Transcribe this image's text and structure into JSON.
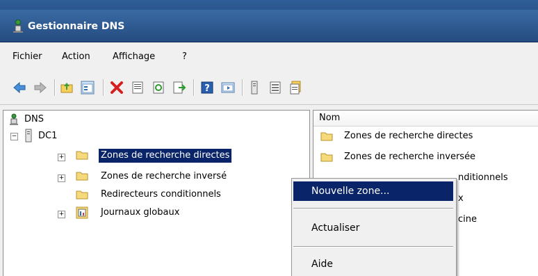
{
  "window": {
    "title": "Gestionnaire DNS"
  },
  "menu": {
    "items": [
      "Fichier",
      "Action",
      "Affichage",
      "?"
    ]
  },
  "toolbar": {
    "buttons": [
      "back-icon",
      "forward-icon",
      "up-folder-icon",
      "show-hide-tree-icon",
      "delete-icon",
      "properties-icon",
      "refresh-icon",
      "export-icon",
      "help-icon",
      "console-icon",
      "server-icon",
      "list-icon",
      "details-icon"
    ]
  },
  "tree": {
    "root": "DNS",
    "server": "DC1",
    "items": [
      {
        "label": "Zones de recherche directes",
        "expander": "+"
      },
      {
        "label": "Zones de recherche inversé",
        "expander": "+"
      },
      {
        "label": "Redirecteurs conditionnels",
        "expander": ""
      },
      {
        "label": "Journaux globaux",
        "expander": "+"
      }
    ],
    "server_expander": "−"
  },
  "list": {
    "column": "Nom",
    "rows": [
      "Zones de recherche directes",
      "Zones de recherche inversée",
      "nditionnels",
      "x",
      "cine"
    ]
  },
  "context_menu": {
    "items": [
      "Nouvelle zone...",
      "Actualiser",
      "Aide"
    ]
  }
}
